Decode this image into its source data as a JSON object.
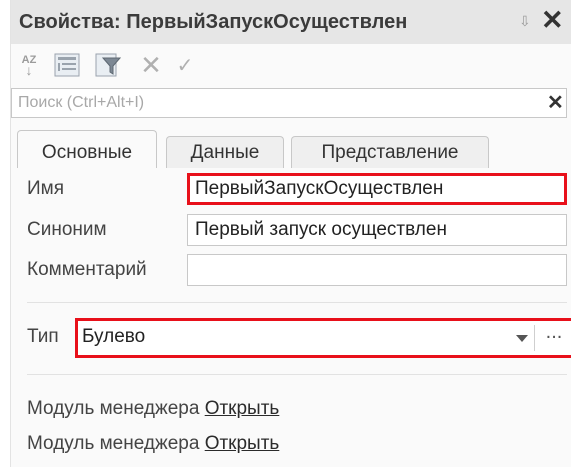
{
  "window": {
    "title": "Свойства: ПервыйЗапускОсуществлен",
    "pin_glyph": "⇩",
    "close_glyph": "✕"
  },
  "toolbar": {
    "sort_top": "AZ",
    "remove_glyph": "✕",
    "check_glyph": "✓"
  },
  "search": {
    "placeholder": "Поиск (Ctrl+Alt+I)",
    "clear_glyph": "✕"
  },
  "tabs": [
    {
      "label": "Основные",
      "active": true
    },
    {
      "label": "Данные",
      "active": false
    },
    {
      "label": "Представление",
      "active": false
    }
  ],
  "fields": {
    "name": {
      "label": "Имя",
      "value": "ПервыйЗапускОсуществлен"
    },
    "synonym": {
      "label": "Синоним",
      "value": "Первый запуск осуществлен"
    },
    "comment": {
      "label": "Комментарий",
      "value": ""
    }
  },
  "type": {
    "label": "Тип",
    "value": "Булево",
    "select_glyph": "..."
  },
  "modules": [
    {
      "label": "Модуль менеджера",
      "link": "Открыть"
    },
    {
      "label": "Модуль менеджера",
      "link": "Открыть"
    }
  ],
  "colors": {
    "highlight": "#e8101a",
    "titlebar": "#e6e6e6"
  }
}
